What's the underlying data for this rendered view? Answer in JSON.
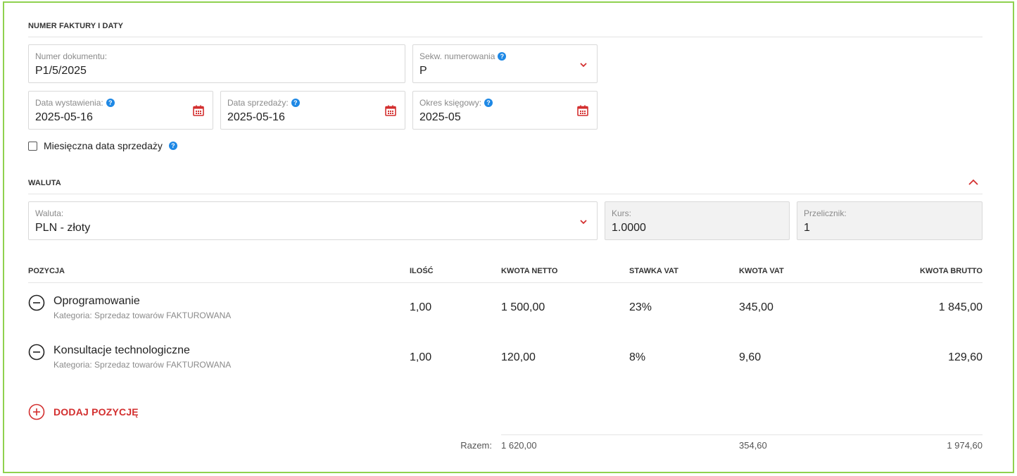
{
  "sections": {
    "invoice": "NUMER FAKTURY I DATY",
    "currency": "WALUTA",
    "positions": "POZYCJA"
  },
  "fields": {
    "doc_number": {
      "label": "Numer dokumentu:",
      "value": "P1/5/2025"
    },
    "sequence": {
      "label": "Sekw. numerowania",
      "value": "P"
    },
    "issue_date": {
      "label": "Data wystawienia:",
      "value": "2025-05-16"
    },
    "sale_date": {
      "label": "Data sprzedaży:",
      "value": "2025-05-16"
    },
    "period": {
      "label": "Okres księgowy:",
      "value": "2025-05"
    },
    "monthly_checkbox": {
      "label": "Miesięczna data sprzedaży",
      "checked": false
    },
    "currency": {
      "label": "Waluta:",
      "value": "PLN - złoty"
    },
    "rate": {
      "label": "Kurs:",
      "value": "1.0000"
    },
    "converter": {
      "label": "Przelicznik:",
      "value": "1"
    }
  },
  "table": {
    "headers": {
      "position": "POZYCJA",
      "qty": "ILOŚĆ",
      "net": "KWOTA NETTO",
      "vat_rate": "STAWKA VAT",
      "vat": "KWOTA VAT",
      "gross": "KWOTA BRUTTO"
    },
    "rows": [
      {
        "name": "Oprogramowanie",
        "category": "Kategoria: Sprzedaz towarów FAKTUROWANA",
        "qty": "1,00",
        "net": "1 500,00",
        "vat_rate": "23%",
        "vat": "345,00",
        "gross": "1 845,00"
      },
      {
        "name": "Konsultacje technologiczne",
        "category": "Kategoria: Sprzedaz towarów FAKTUROWANA",
        "qty": "1,00",
        "net": "120,00",
        "vat_rate": "8%",
        "vat": "9,60",
        "gross": "129,60"
      }
    ],
    "add_label": "DODAJ POZYCJĘ",
    "totals": {
      "label": "Razem:",
      "net": "1 620,00",
      "vat": "354,60",
      "gross": "1 974,60"
    }
  },
  "colors": {
    "accent": "#d32f2f",
    "help": "#1e88e5",
    "frame": "#8fd14f"
  }
}
